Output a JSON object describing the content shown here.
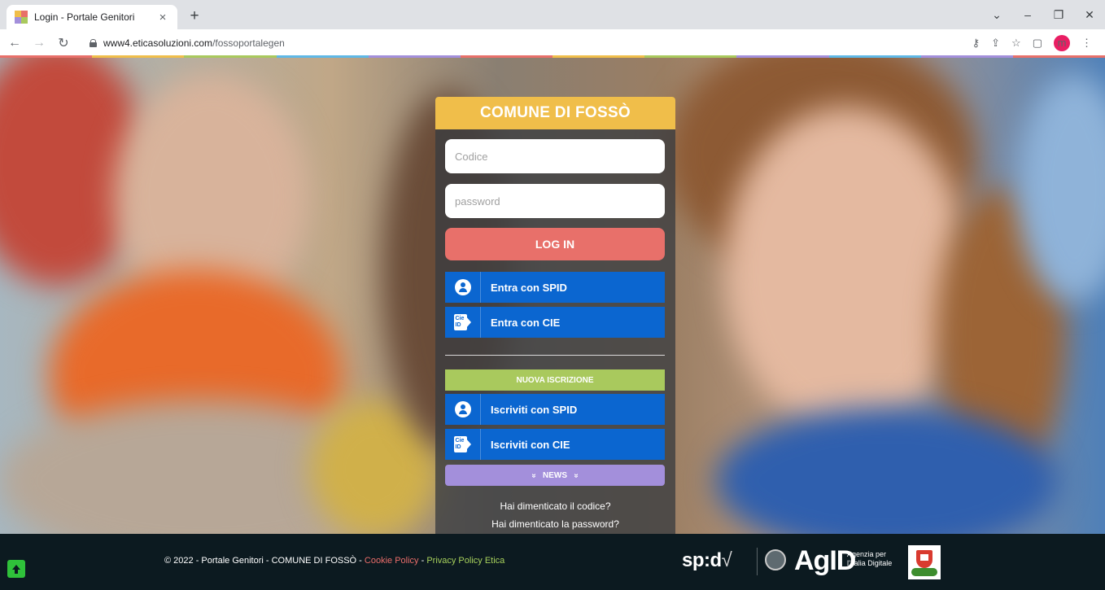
{
  "browser": {
    "tab_title": "Login - Portale Genitori",
    "tab_close": "×",
    "new_tab": "+",
    "url_host": "www4.eticasoluzioni.com",
    "url_path": "/fossoportalegen",
    "profile_initial": "m",
    "window_controls": [
      "⌄",
      "–",
      "❐",
      "✕"
    ]
  },
  "login": {
    "title": "COMUNE DI FOSSÒ",
    "code_placeholder": "Codice",
    "password_placeholder": "password",
    "login_button": "LOG IN",
    "spid_button": "Entra con SPID",
    "cie_button": "Entra con CIE",
    "new_registration": "NUOVA ISCRIZIONE",
    "register_spid": "Iscriviti con SPID",
    "register_cie": "Iscriviti con CIE",
    "news_button": "NEWS",
    "news_chevron": "»",
    "cie_icon_text": "Cie ID",
    "forgot_code": "Hai dimenticato il codice?",
    "forgot_password": "Hai dimenticato la password?"
  },
  "footer": {
    "copyright": "© 2022 - Portale Genitori - COMUNE DI FOSSÒ - ",
    "cookie_policy": "Cookie Policy",
    "separator": " - ",
    "privacy_policy": "Privacy Policy Etica",
    "spid_logo": "sp:d",
    "spid_check": "√",
    "agid_logo": "AgID",
    "agid_sub_1": "Agenzia per",
    "agid_sub_2": "l'Italia Digitale"
  },
  "colors": {
    "header_yellow": "#f0be4a",
    "login_red": "#e8706a",
    "spid_blue": "#0b66d0",
    "new_green": "#a9c95d",
    "news_purple": "#a38fdb",
    "footer_bg": "#0c1a20",
    "up_green": "#2fc13a"
  }
}
